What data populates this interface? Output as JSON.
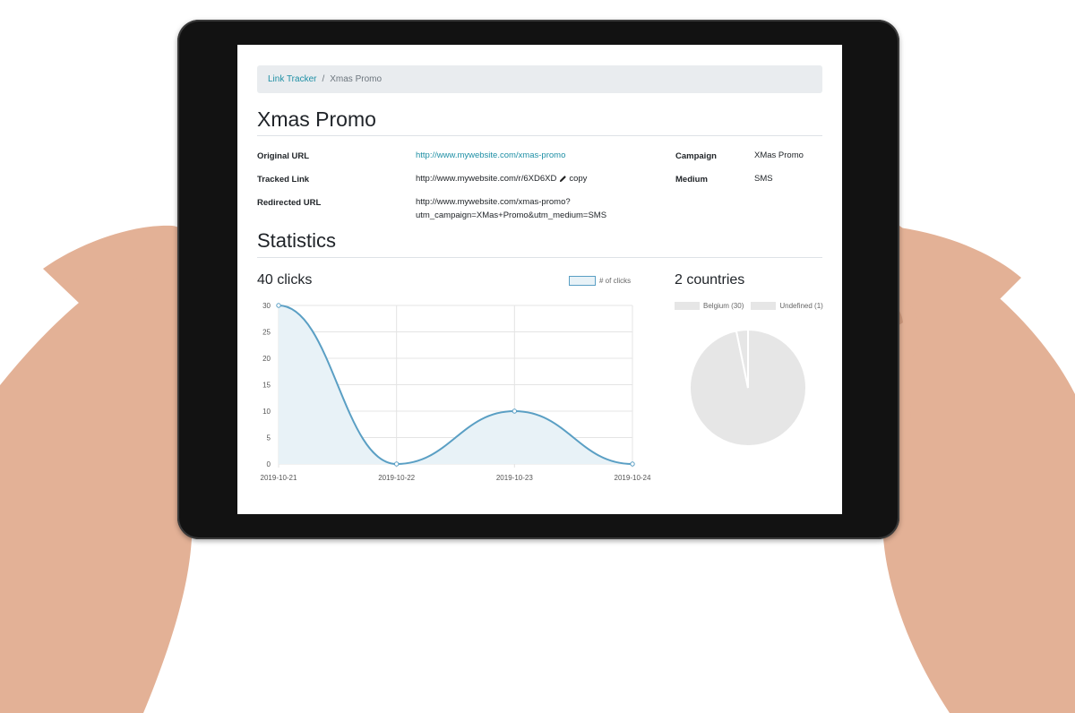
{
  "breadcrumb": {
    "root": "Link Tracker",
    "separator": "/",
    "current": "Xmas Promo"
  },
  "page": {
    "title": "Xmas Promo"
  },
  "details": {
    "original_url_label": "Original URL",
    "original_url_value": "http://www.mywebsite.com/xmas-promo",
    "tracked_link_label": "Tracked Link",
    "tracked_link_value": "http://www.mywebsite.com/r/6XD6XD",
    "copy_label": "copy",
    "redirected_url_label": "Redirected URL",
    "redirected_url_line1": "http://www.mywebsite.com/xmas-promo?",
    "redirected_url_line2": "utm_campaign=XMas+Promo&utm_medium=SMS",
    "campaign_label": "Campaign",
    "campaign_value": "XMas Promo",
    "medium_label": "Medium",
    "medium_value": "SMS"
  },
  "statistics": {
    "title": "Statistics",
    "clicks_count": "40",
    "clicks_label": "clicks",
    "countries_title": "2 countries"
  },
  "colors": {
    "link": "#1e8fa5",
    "line": "#5a9fc4",
    "area_fill": "#e8f2f7",
    "pie_fill": "#e6e6e6",
    "breadcrumb_bg": "#e9ecef"
  },
  "chart_data": [
    {
      "type": "area",
      "x": [
        "2019-10-21",
        "2019-10-22",
        "2019-10-23",
        "2019-10-24"
      ],
      "series": [
        {
          "name": "# of clicks",
          "values": [
            30,
            0,
            10,
            0
          ]
        }
      ],
      "ylim": [
        0,
        30
      ],
      "yticks": [
        0,
        5,
        10,
        15,
        20,
        25,
        30
      ],
      "legend_position": "top-right",
      "grid": true
    },
    {
      "type": "pie",
      "categories": [
        "Belgium (30)",
        "Undefined (1)"
      ],
      "values": [
        30,
        1
      ],
      "legend_position": "top"
    }
  ]
}
